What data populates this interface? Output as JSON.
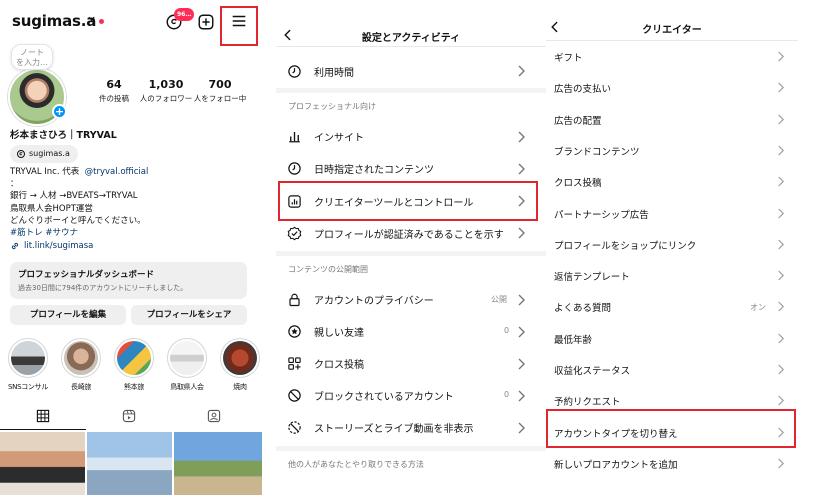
{
  "profile": {
    "username": "sugimas.a",
    "threads_badge": "96…",
    "note_text": "ノート\nを入力…",
    "stats": [
      {
        "number": "64",
        "label": "件の投稿"
      },
      {
        "number": "1,030",
        "label": "人のフォロワー"
      },
      {
        "number": "700",
        "label": "人をフォロー中"
      }
    ],
    "full_name": "杉本まさひろ｜TRYVAL",
    "threads_handle": "sugimas.a",
    "bio_line1_a": "TRYVAL Inc. 代表",
    "bio_line1_mention": "@tryval.official",
    "bio_line2": "：",
    "bio_line3": "銀行 → 人材 →BVEATS→TRYVAL",
    "bio_line4": "鳥取県人会HOPT運営",
    "bio_line5": "どんぐりボーイと呼んでください。",
    "bio_hashtags": "#筋トレ #サウナ",
    "link": "lit.link/sugimasa",
    "dashboard_title": "プロフェッショナルダッシュボード",
    "dashboard_subtitle": "過去30日間に794件のアカウントにリーチしました。",
    "edit_button": "プロフィールを編集",
    "share_button": "プロフィールをシェア",
    "highlights": [
      {
        "label": "SNSコンサル"
      },
      {
        "label": "長崎旅"
      },
      {
        "label": "熊本旅"
      },
      {
        "label": "鳥取県人会"
      },
      {
        "label": "焼肉"
      }
    ]
  },
  "settings": {
    "title": "設定とアクティビティ",
    "usage_time": "利用時間",
    "section_pro": "プロフェッショナル向け",
    "insights": "インサイト",
    "scheduled": "日時指定されたコンテンツ",
    "creator_tools": "クリエイターツールとコントロール",
    "verified": "プロフィールが認証済みであることを示す",
    "section_content": "コンテンツの公開範囲",
    "privacy": "アカウントのプライバシー",
    "privacy_value": "公開",
    "close_friends": "親しい友達",
    "close_friends_count": "0",
    "crosspost": "クロス投稿",
    "blocked": "ブロックされているアカウント",
    "blocked_count": "0",
    "hide_stories": "ストーリーズとライブ動画を非表示",
    "section_interact": "他の人があなたとやり取りできる方法"
  },
  "creator": {
    "title": "クリエイター",
    "items": [
      {
        "label": "ギフト",
        "value": ""
      },
      {
        "label": "広告の支払い",
        "value": ""
      },
      {
        "label": "広告の配置",
        "value": ""
      },
      {
        "label": "ブランドコンテンツ",
        "value": ""
      },
      {
        "label": "クロス投稿",
        "value": ""
      },
      {
        "label": "パートナーシップ広告",
        "value": ""
      },
      {
        "label": "プロフィールをショップにリンク",
        "value": ""
      },
      {
        "label": "返信テンプレート",
        "value": ""
      },
      {
        "label": "よくある質問",
        "value": "オン"
      },
      {
        "label": "最低年齢",
        "value": ""
      },
      {
        "label": "収益化ステータス",
        "value": ""
      },
      {
        "label": "予約リクエスト",
        "value": ""
      },
      {
        "label": "アカウントタイプを切り替え",
        "value": ""
      },
      {
        "label": "新しいプロアカウントを追加",
        "value": ""
      }
    ]
  },
  "colors": {
    "highlight_box": "#e3262d",
    "link_blue": "#00376b",
    "badge_red": "#ff2d55",
    "action_blue": "#0095f6"
  }
}
